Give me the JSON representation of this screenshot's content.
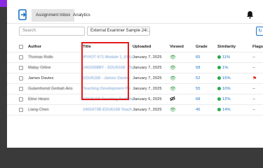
{
  "tabs": {
    "inbox": "Assignment Inbox",
    "analytics": "Analytics"
  },
  "toolbar": {
    "search_placeholder": "Search",
    "filter_value": "External Examiner Sample 24/..."
  },
  "columns": {
    "author": "Author",
    "title": "Title",
    "uploaded": "Uploaded",
    "viewed": "Viewed",
    "grade": "Grade",
    "similarity": "Similarity",
    "flags": "Flags"
  },
  "rows": [
    {
      "author": "Thomas Rollo",
      "title": "IPVIOT 671 Module 1_EDU",
      "uploaded": "January 7, 2025",
      "viewed": "eye",
      "grade": "65",
      "similarity": "11%",
      "flags": "--"
    },
    {
      "author": "Malay Orline",
      "title": "2401658BY - EDU6168 - Te",
      "uploaded": "January 7, 2025",
      "viewed": "eye",
      "grade": "58",
      "similarity": "1%",
      "flags": "--"
    },
    {
      "author": "James Davies",
      "title": "EDU6168 - James Davies",
      "uploaded": "January 7, 2025",
      "viewed": "eye",
      "grade": "52",
      "similarity": "15%",
      "flags": "flag"
    },
    {
      "author": "Gulamhsmd Gerbah Aris",
      "title": "Teaching Development Po",
      "uploaded": "January 7, 2025",
      "viewed": "eye",
      "grade": "55",
      "similarity": "10%",
      "flags": "--"
    },
    {
      "author": "Eline Hearn",
      "title": "EDU6168 Teaching Portfolio",
      "uploaded": "January 6, 2025",
      "viewed": "eye-off",
      "grade": "68",
      "similarity": "12%",
      "flags": "--"
    },
    {
      "author": "Liang Chen",
      "title": "2402473B EDU6168 Teach",
      "uploaded": "January 7, 2025",
      "viewed": "eye",
      "grade": "45",
      "similarity": "14%",
      "flags": "--"
    }
  ],
  "colors": {
    "accent": "#1a73c8",
    "similarity_ok": "#2aa84a",
    "flag": "#d9261c",
    "highlight": "#e11b1b"
  }
}
